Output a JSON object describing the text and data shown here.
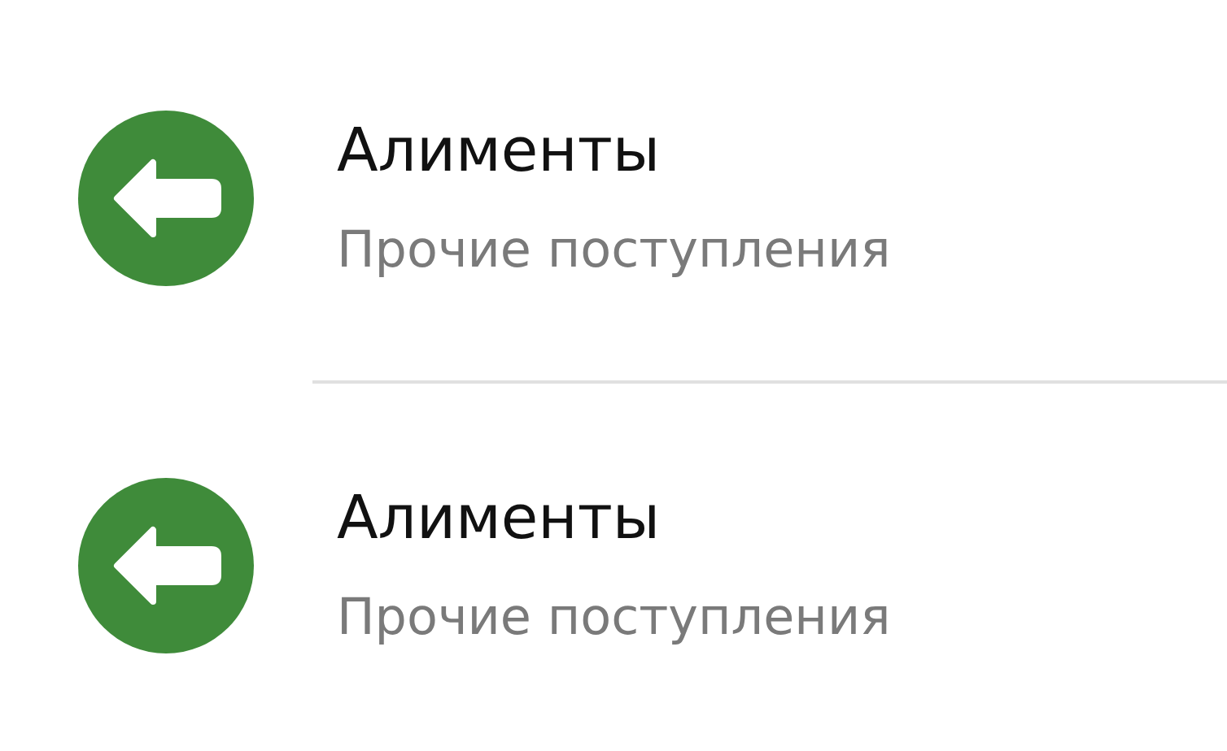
{
  "transactions": [
    {
      "kind": "incoming",
      "title": "Алименты",
      "category": "Прочие поступления"
    },
    {
      "kind": "incoming",
      "title": "Алименты",
      "category": "Прочие поступления"
    }
  ]
}
